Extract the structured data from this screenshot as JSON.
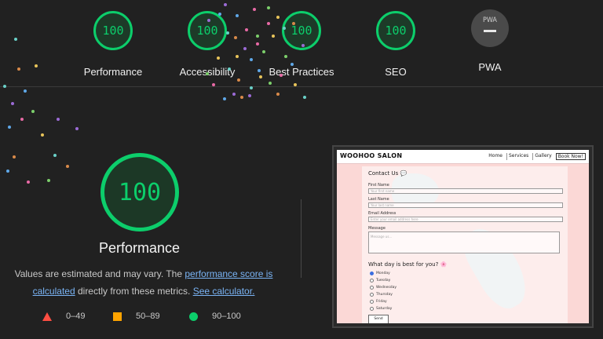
{
  "top_gauges": [
    {
      "score": "100",
      "label": "Performance",
      "color": "#0cce6b"
    },
    {
      "score": "100",
      "label": "Accessibility",
      "color": "#0cce6b"
    },
    {
      "score": "100",
      "label": "Best Practices",
      "color": "#0cce6b"
    },
    {
      "score": "100",
      "label": "SEO",
      "color": "#0cce6b"
    }
  ],
  "pwa": {
    "badge_text": "PWA",
    "label": "PWA",
    "icon": "dash-icon"
  },
  "main": {
    "score": "100",
    "title": "Performance",
    "desc_part1": "Values are estimated and may vary. The ",
    "desc_link1": "performance score is calculated",
    "desc_part2": " directly from these metrics. ",
    "desc_link2": "See calculator."
  },
  "legend": [
    {
      "range": "0–49",
      "icon": "red-triangle-icon",
      "color": "#ff4e42"
    },
    {
      "range": "50–89",
      "icon": "orange-square-icon",
      "color": "#ffa400"
    },
    {
      "range": "90–100",
      "icon": "green-circle-icon",
      "color": "#0cce6b"
    }
  ],
  "preview": {
    "brand": "WOOHOO SALON",
    "nav": [
      "Home",
      "Services",
      "Gallery",
      "Book Now!"
    ],
    "form_title": "Contact Us 💬",
    "fields": [
      {
        "label": "First Name",
        "placeholder": "Your first name"
      },
      {
        "label": "Last Name",
        "placeholder": "Your last name"
      },
      {
        "label": "Email Address",
        "placeholder": "Enter your email address here"
      }
    ],
    "message_label": "Message",
    "message_placeholder": "Message us...",
    "question": "What day is best for you? 🌸",
    "days": [
      "Monday",
      "Tuesday",
      "Wednesday",
      "Thursday",
      "Friday",
      "Saturday"
    ],
    "send": "Send"
  }
}
